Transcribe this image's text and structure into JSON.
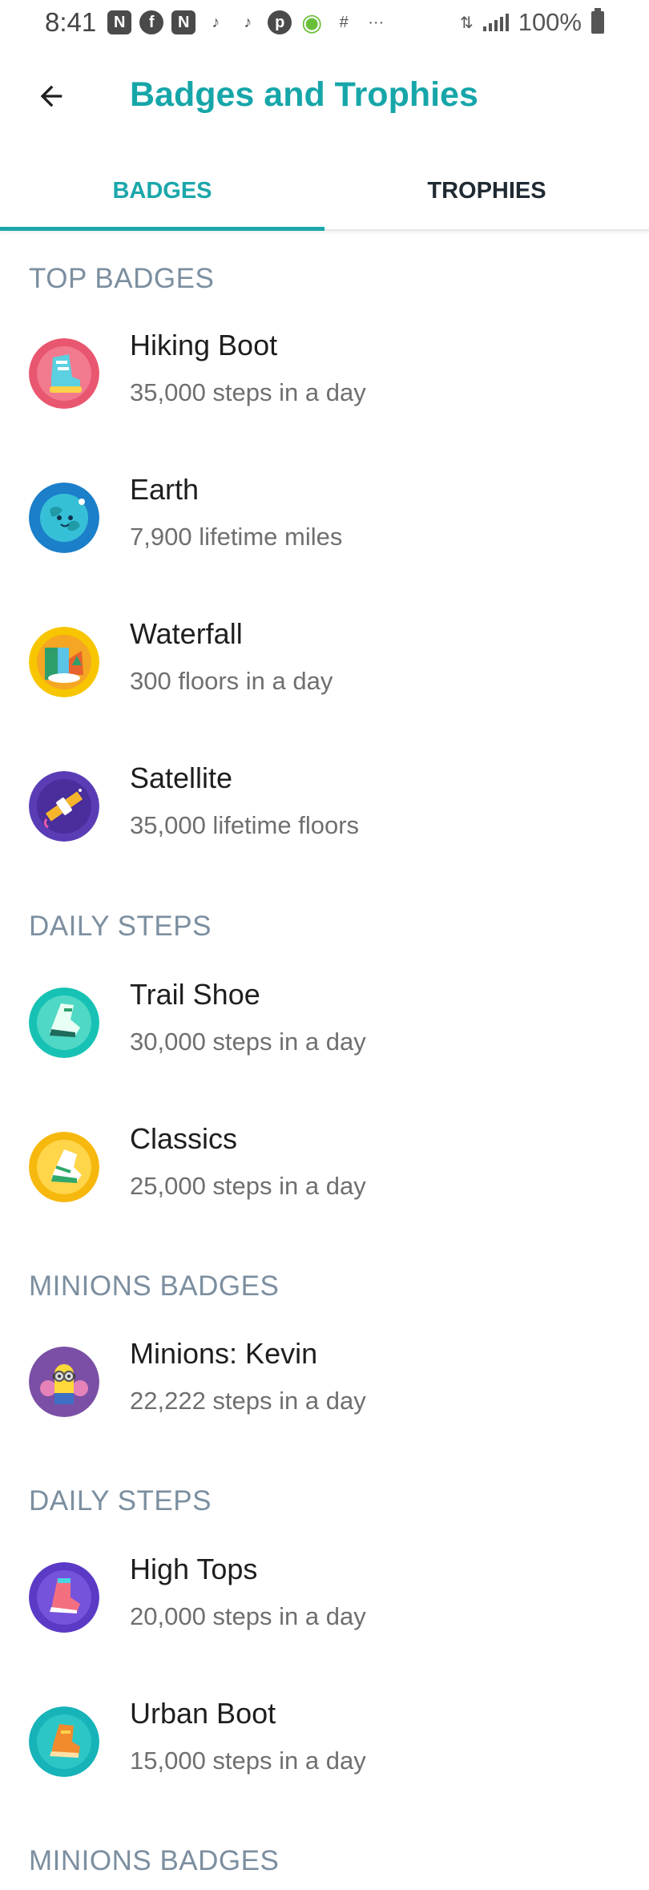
{
  "status_bar": {
    "time": "8:41",
    "battery": "100%",
    "notification_icons": [
      "n-icon",
      "facebook-icon",
      "n-icon",
      "tiktok-icon",
      "tiktok-icon",
      "pinterest-icon",
      "search-app-icon",
      "grid-icon",
      "more-icon"
    ]
  },
  "header": {
    "title": "Badges and Trophies"
  },
  "tabs": [
    {
      "label": "BADGES",
      "selected": true
    },
    {
      "label": "TROPHIES",
      "selected": false
    }
  ],
  "sections": [
    {
      "title": "TOP BADGES",
      "items": [
        {
          "name": "Hiking Boot",
          "desc": "35,000 steps in a day",
          "color": "#e9566f"
        },
        {
          "name": "Earth",
          "desc": "7,900 lifetime miles",
          "color": "#1b7fc9"
        },
        {
          "name": "Waterfall",
          "desc": "300 floors in a day",
          "color": "#f7c600"
        },
        {
          "name": "Satellite",
          "desc": "35,000 lifetime floors",
          "color": "#5a3db5"
        }
      ]
    },
    {
      "title": "DAILY STEPS",
      "items": [
        {
          "name": "Trail Shoe",
          "desc": "30,000 steps in a day",
          "color": "#17c2b5"
        },
        {
          "name": "Classics",
          "desc": "25,000 steps in a day",
          "color": "#f6b80d"
        }
      ]
    },
    {
      "title": "MINIONS BADGES",
      "items": [
        {
          "name": "Minions: Kevin",
          "desc": "22,222 steps in a day",
          "color": "#7b4fa6"
        }
      ]
    },
    {
      "title": "DAILY STEPS",
      "items": [
        {
          "name": "High Tops",
          "desc": "20,000 steps in a day",
          "color": "#5b3ac6"
        },
        {
          "name": "Urban Boot",
          "desc": "15,000 steps in a day",
          "color": "#16b3b8"
        }
      ]
    },
    {
      "title": "MINIONS BADGES",
      "items": []
    }
  ]
}
